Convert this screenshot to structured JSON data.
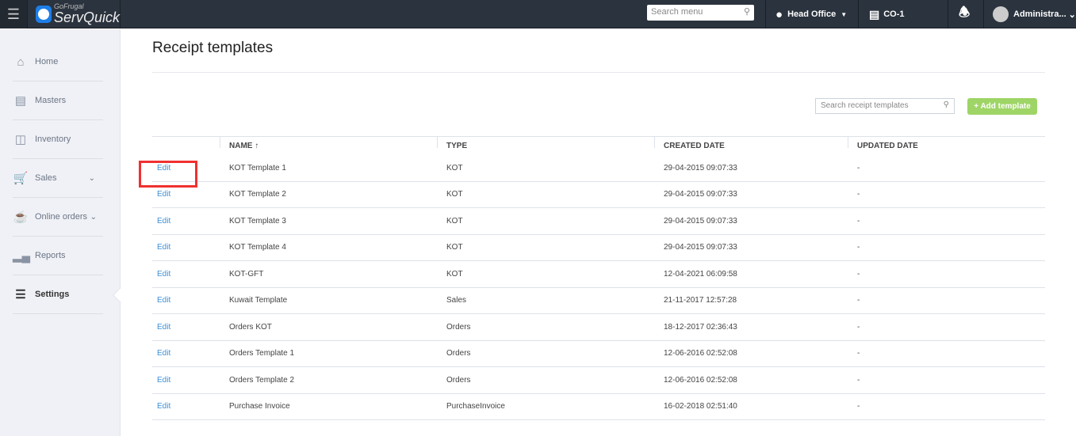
{
  "header": {
    "logo_small": "GoFrugal",
    "logo_main": "ServQuick",
    "search_placeholder": "Search menu",
    "location": "Head Office",
    "counter": "CO-1",
    "user": "Administra..."
  },
  "sidebar": {
    "items": [
      {
        "label": "Home",
        "icon": "home-icon"
      },
      {
        "label": "Masters",
        "icon": "masters-icon"
      },
      {
        "label": "Inventory",
        "icon": "inventory-icon"
      },
      {
        "label": "Sales",
        "icon": "cart-icon"
      },
      {
        "label": "Online orders",
        "icon": "online-orders-icon"
      },
      {
        "label": "Reports",
        "icon": "reports-icon"
      },
      {
        "label": "Settings",
        "icon": "settings-icon"
      }
    ]
  },
  "page": {
    "title": "Receipt templates",
    "search_placeholder": "Search receipt templates",
    "add_button": "+ Add template"
  },
  "table": {
    "columns": [
      "",
      "NAME ↑",
      "TYPE",
      "CREATED DATE",
      "UPDATED DATE"
    ],
    "rows": [
      {
        "action": "Edit",
        "name": "KOT Template 1",
        "type": "KOT",
        "created": "29-04-2015 09:07:33",
        "updated": "-"
      },
      {
        "action": "Edit",
        "name": "KOT Template 2",
        "type": "KOT",
        "created": "29-04-2015 09:07:33",
        "updated": "-"
      },
      {
        "action": "Edit",
        "name": "KOT Template 3",
        "type": "KOT",
        "created": "29-04-2015 09:07:33",
        "updated": "-"
      },
      {
        "action": "Edit",
        "name": "KOT Template 4",
        "type": "KOT",
        "created": "29-04-2015 09:07:33",
        "updated": "-"
      },
      {
        "action": "Edit",
        "name": "KOT-GFT",
        "type": "KOT",
        "created": "12-04-2021 06:09:58",
        "updated": "-"
      },
      {
        "action": "Edit",
        "name": "Kuwait Template",
        "type": "Sales",
        "created": "21-11-2017 12:57:28",
        "updated": "-"
      },
      {
        "action": "Edit",
        "name": "Orders KOT",
        "type": "Orders",
        "created": "18-12-2017 02:36:43",
        "updated": "-"
      },
      {
        "action": "Edit",
        "name": "Orders Template 1",
        "type": "Orders",
        "created": "12-06-2016 02:52:08",
        "updated": "-"
      },
      {
        "action": "Edit",
        "name": "Orders Template 2",
        "type": "Orders",
        "created": "12-06-2016 02:52:08",
        "updated": "-"
      },
      {
        "action": "Edit",
        "name": "Purchase Invoice",
        "type": "PurchaseInvoice",
        "created": "16-02-2018 02:51:40",
        "updated": "-"
      }
    ]
  },
  "colors": {
    "topbar": "#2b333e",
    "accent_button": "#9ed566",
    "link": "#3b8fd6",
    "highlight": "#f03030"
  }
}
